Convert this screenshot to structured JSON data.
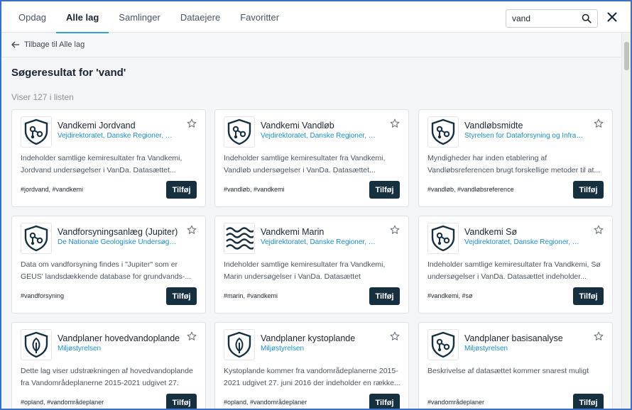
{
  "tabs": [
    {
      "label": "Opdag"
    },
    {
      "label": "Alle lag",
      "active": true
    },
    {
      "label": "Samlinger"
    },
    {
      "label": "Dataejere"
    },
    {
      "label": "Favoritter"
    }
  ],
  "search": {
    "value": "vand"
  },
  "back_label": "Tilbage til Alle lag",
  "title": "Søgeresultat for 'vand'",
  "count": "Viser 127 i listen",
  "add_label": "Tilføj",
  "colors": {
    "accent": "#2aa6d6",
    "link": "#1a8fc7",
    "button": "#173040",
    "frame": "#3a6fc4"
  },
  "cards": [
    {
      "title": "Vandkemi Jordvand",
      "orgs": "Vejdirektoratet, Danske Regioner, Miljøstyrelsen",
      "desc_1": "Indeholder samtlige kemiresultater fra Vandkemi,",
      "desc_2": "Jordvand undersøgelser i VanDa. Datasættet...",
      "tags": "#jordvand, #vandkemi",
      "icon": "shield-network-icon"
    },
    {
      "title": "Vandkemi Vandløb",
      "orgs": "Vejdirektoratet, Danske Regioner, Miljøstyrelsen",
      "desc_1": "Indeholder samtlige kemiresultater fra Vandkemi,",
      "desc_2": "Vandløb undersøgelser i VanDa. Datasættet...",
      "tags": "#vandløb, #vandkemi",
      "icon": "shield-network-icon"
    },
    {
      "title": "Vandløbsmidte",
      "orgs": "Styrelsen for Dataforsyning og Infrastruktur",
      "desc_1": "Myndigheder har inden etablering af",
      "desc_2": "Vandløbsreferencen brugt forskellige metoder til at...",
      "tags": "#vandløb, #vandløbsreference",
      "icon": "shield-network-icon"
    },
    {
      "title": "Vandforsyningsanlæg (Jupiter)",
      "orgs": "De Nationale Geologiske Undersøgelser for Danmark og Grønland",
      "desc_1": "Data om vandforsyning findes i \"Jupiter\" som er",
      "desc_2": "GEUS' landsdækkende database for grundvands-...",
      "tags": "#vandforsyning",
      "icon": "shield-network-icon"
    },
    {
      "title": "Vandkemi Marin",
      "orgs": "Vejdirektoratet, Danske Regioner, Miljøstyrelsen",
      "desc_1": "Indeholder samtlige kemiresultater fra Vandkemi,",
      "desc_2": "Marin undersøgelser i VanDa. Datasættet indeholder...",
      "tags": "#marin, #vandkemi",
      "icon": "waves-icon"
    },
    {
      "title": "Vandkemi Sø",
      "orgs": "Vejdirektoratet, Danske Regioner, Miljøstyrelsen",
      "desc_1": "Indeholder samtlige kemiresultater fra Vandkemi, Sø",
      "desc_2": "undersøgelser i VanDa. Datasættet indeholder...",
      "tags": "#vandkemi, #sø",
      "icon": "shield-network-icon"
    },
    {
      "title": "Vandplaner hovedvandoplande",
      "orgs": "Miljøstyrelsen",
      "desc_1": "Dette lag viser udstrækningen af hovedvandoplande",
      "desc_2": "fra Vandområdeplanerne 2015-2021 udgivet 27. juni...",
      "tags": "#opland, #vandområdeplaner",
      "icon": "shield-leaf-icon"
    },
    {
      "title": "Vandplaner kystoplande",
      "orgs": "Miljøstyrelsen",
      "desc_1": "Kystoplande kommer fra vandområdeplanerne 2015-",
      "desc_2": "2021 udgivet 27. juni 2016 der indeholder en række...",
      "tags": "#opland, #vandområdeplaner",
      "icon": "shield-leaf-icon"
    },
    {
      "title": "Vandplaner basisanalyse",
      "orgs": "Miljøstyrelsen",
      "desc_1": "Beskrivelse af datasættet kommer snarest muligt",
      "desc_2": "",
      "tags": "#vandområdeplaner",
      "icon": "shield-network-icon"
    }
  ]
}
